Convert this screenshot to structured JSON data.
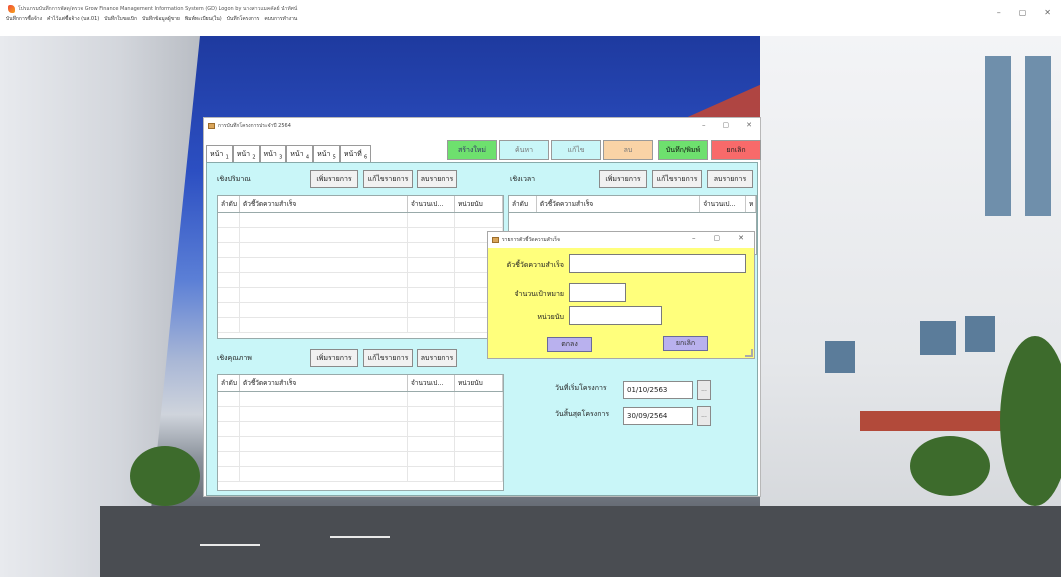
{
  "app": {
    "title": "โปรแกรมบันทึกการพัสดุ/ตรวจ Grow Finance Management Information System (GD) Logon by นางสาวแมคคัลย์ นำทัศน์",
    "menu": [
      "บันทึกการซื้อจ้าง",
      "คำไว้แต่ซื้อจ้าง (บส.01)",
      "บันทึกใบขอเบิก",
      "บันทึกข้อมูลผู้ขาย",
      "พิมพ์ทะเบียน(ใน)",
      "บันทึกโครงการ",
      "คบบการทำงาน"
    ],
    "window_controls": [
      "–",
      "▢",
      "✕"
    ]
  },
  "form": {
    "title": "การบันทึกโครงการประจำปี 2564",
    "window_controls": [
      "–",
      "▢",
      "✕"
    ],
    "tabs": [
      {
        "label": "หน้า",
        "num": "1"
      },
      {
        "label": "หน้า",
        "num": "2"
      },
      {
        "label": "หน้า",
        "num": "3"
      },
      {
        "label": "หน้า",
        "num": "4"
      },
      {
        "label": "หน้า",
        "num": "5"
      },
      {
        "label": "หน้าที่",
        "num": "6"
      }
    ],
    "toolbar": {
      "new": "สร้างใหม่",
      "search": "ค้นหา",
      "edit": "แก้ไข",
      "delete": "ลบ",
      "save_print": "บันทึก/พิมพ์",
      "cancel": "ยกเลิก"
    },
    "quantity": {
      "label": "เชิงปริมาณ",
      "add": "เพิ่มรายการ",
      "edit": "แก้ไขรายการ",
      "delete": "ลบรายการ",
      "columns": [
        "ลำดับ",
        "ตัวชี้วัดความสำเร็จ",
        "จำนวนเป...",
        "หน่วยนับ"
      ]
    },
    "time": {
      "label": "เชิงเวลา",
      "add": "เพิ่มรายการ",
      "edit": "แก้ไขรายการ",
      "delete": "ลบรายการ",
      "columns": [
        "ลำดับ",
        "ตัวชี้วัดความสำเร็จ",
        "จำนวนเป...",
        "ห"
      ]
    },
    "quality": {
      "label": "เชิงคุณภาพ",
      "add": "เพิ่มรายการ",
      "edit": "แก้ไขรายการ",
      "delete": "ลบรายการ",
      "columns": [
        "ลำดับ",
        "ตัวชี้วัดความสำเร็จ",
        "จำนวนเป...",
        "หน่วยนับ"
      ]
    },
    "dates": {
      "start_label": "วันที่เริ่มโครงการ",
      "start_value": "01/10/2563",
      "end_label": "วันสิ้นสุดโครงการ",
      "end_value": "30/09/2564",
      "picker_label": "..."
    }
  },
  "popup": {
    "title": "รายการตัวชี้วัดความสำเร็จ",
    "window_controls": [
      "–",
      "▢",
      "✕"
    ],
    "fields": {
      "indicator_label": "ตัวชี้วัดความสำเร็จ",
      "target_label": "จำนวนเป้าหมาย",
      "unit_label": "หน่วยนับ"
    },
    "ok": "ตกลง",
    "cancel": "ยกเลิก"
  },
  "colors": {
    "tab_panel": "#c9f6f8",
    "popup_body": "#ffff7c",
    "btn_green": "#6ee06e",
    "btn_red": "#f86a6a",
    "btn_orange": "#f9d3a6",
    "btn_purple": "#b9b1ee"
  }
}
